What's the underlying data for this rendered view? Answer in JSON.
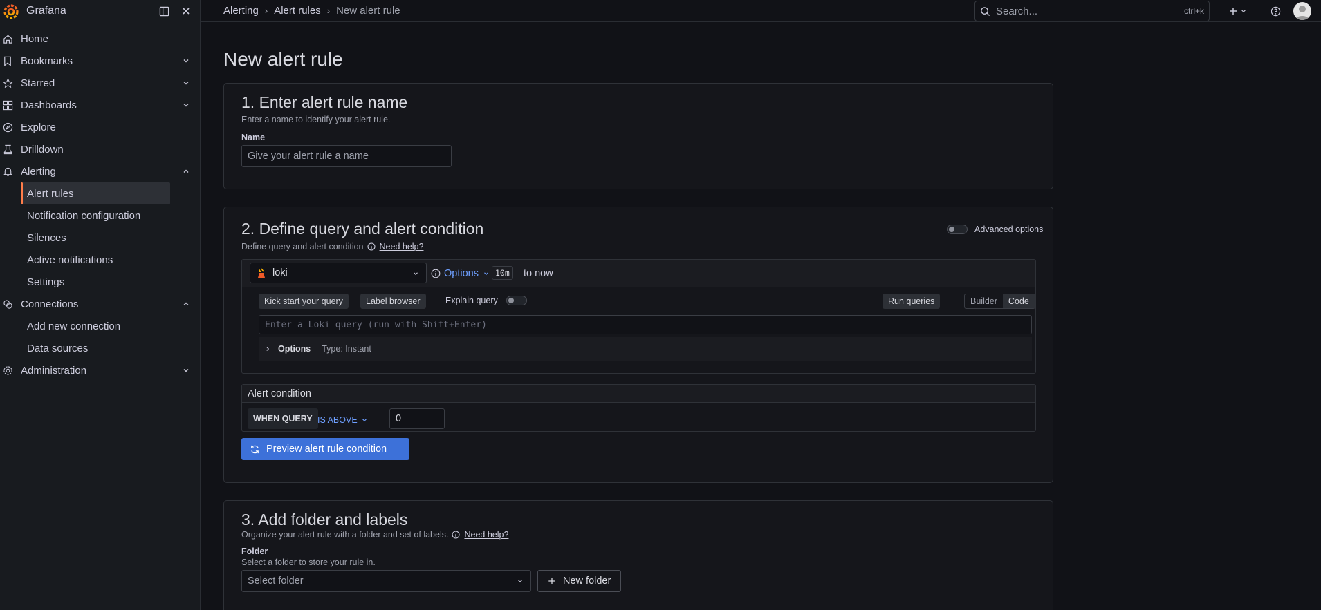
{
  "sidebar": {
    "app_name": "Grafana",
    "items": [
      {
        "label": "Home",
        "icon": "home-icon"
      },
      {
        "label": "Bookmarks",
        "icon": "bookmark-icon"
      },
      {
        "label": "Starred",
        "icon": "star-icon"
      },
      {
        "label": "Dashboards",
        "icon": "apps-icon"
      },
      {
        "label": "Explore",
        "icon": "compass-icon"
      },
      {
        "label": "Drilldown",
        "icon": "drilldown-icon"
      },
      {
        "label": "Alerting",
        "icon": "bell-icon"
      },
      {
        "label": "Connections",
        "icon": "link-icon"
      },
      {
        "label": "Administration",
        "icon": "cog-icon"
      }
    ],
    "alerting_sub": [
      "Alert rules",
      "Notification configuration",
      "Silences",
      "Active notifications",
      "Settings"
    ],
    "connections_sub": [
      "Add new connection",
      "Data sources"
    ]
  },
  "topbar": {
    "breadcrumbs": [
      "Alerting",
      "Alert rules",
      "New alert rule"
    ],
    "search_placeholder": "Search...",
    "search_shortcut": "ctrl+k"
  },
  "page": {
    "title": "New alert rule"
  },
  "section1": {
    "heading": "1. Enter alert rule name",
    "description": "Enter a name to identify your alert rule.",
    "name_label": "Name",
    "name_placeholder": "Give your alert rule a name"
  },
  "section2": {
    "heading": "2. Define query and alert condition",
    "description": "Define query and alert condition",
    "help_link": "Need help?",
    "advanced_options_label": "Advanced options",
    "datasource": "loki",
    "options_label": "Options",
    "time_range_badge": "10m",
    "time_range_suffix": "to now",
    "kick_start_label": "Kick start your query",
    "label_browser_label": "Label browser",
    "explain_query_label": "Explain query",
    "run_queries_label": "Run queries",
    "mode_builder": "Builder",
    "mode_code": "Code",
    "query_placeholder": "Enter a Loki query (run with Shift+Enter)",
    "query_options_label": "Options",
    "query_options_type": "Type: Instant",
    "alert_condition_title": "Alert condition",
    "when_query_label": "WHEN QUERY",
    "is_above_label": "IS ABOVE",
    "threshold_value": "0",
    "preview_button": "Preview alert rule condition"
  },
  "section3": {
    "heading": "3. Add folder and labels",
    "description": "Organize your alert rule with a folder and set of labels.",
    "help_link": "Need help?",
    "folder_label": "Folder",
    "folder_description": "Select a folder to store your rule in.",
    "folder_placeholder": "Select folder",
    "new_folder_button": "New folder"
  },
  "colors": {
    "primary": "#3d71d9",
    "accent": "#ff7d4a",
    "link": "#6e9fff"
  }
}
